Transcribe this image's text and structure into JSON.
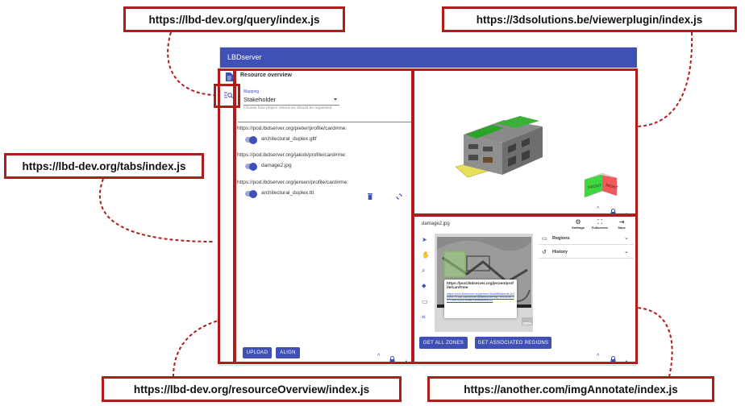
{
  "callouts": {
    "query": "https://lbd-dev.org/query/index.js",
    "viewer": "https://3dsolutions.be/viewerplugin/index.js",
    "tabs": "https://lbd-dev.org/tabs/index.js",
    "resource": "https://lbd-dev.org/resourceOverview/index.js",
    "annotate": "https://another.com/imgAnnotate/index.js"
  },
  "app": {
    "title": "LBDserver"
  },
  "resource_overview": {
    "title": "Resource overview",
    "mapping_label": "Mapping",
    "mapping_value": "Stakeholder",
    "mapping_helper": "Choose how project resources should be organised",
    "groups": [
      {
        "webid": "https://pod.lbdserver.org/pieter/profile/card#me:",
        "file": "architectural_duplex.gltf"
      },
      {
        "webid": "https://pod.lbdserver.org/jakob/profile/card#me:",
        "file": "damage2.jpg"
      },
      {
        "webid": "https://pod.lbdserver.org/jeroen/profile/card#me:",
        "file": "architectural_duplex.ttl"
      }
    ],
    "upload_label": "UPLOAD",
    "align_label": "ALIGN"
  },
  "viewer": {
    "cube_front": "FRONT",
    "cube_right": "RIGHT"
  },
  "annotate": {
    "image_name": "damage2.jpg",
    "settings_label": "Settings",
    "fullscreen_label": "Fullscreen",
    "save_label": "Save",
    "regions_label": "Regions",
    "history_label": "History",
    "popup_title": "https://pod.lbdserver.org/jeroen/profile/card#me",
    "popup_link": "https://pod.lbdserver.org/jeroen/3ba6f9dabbde-fc3c4ce1-f0da-c8b9dd9e0a/article/#entity-89c0e4b-31-72c8-4325-b2b8-f0c9f6d2c4123",
    "zoom_label": "100%",
    "get_zones_label": "GET ALL ZONES",
    "get_regions_label": "GET ASSOCIATED REGIONS"
  },
  "colors": {
    "accent": "#3f51b5",
    "callout_border": "#b01c1c"
  }
}
